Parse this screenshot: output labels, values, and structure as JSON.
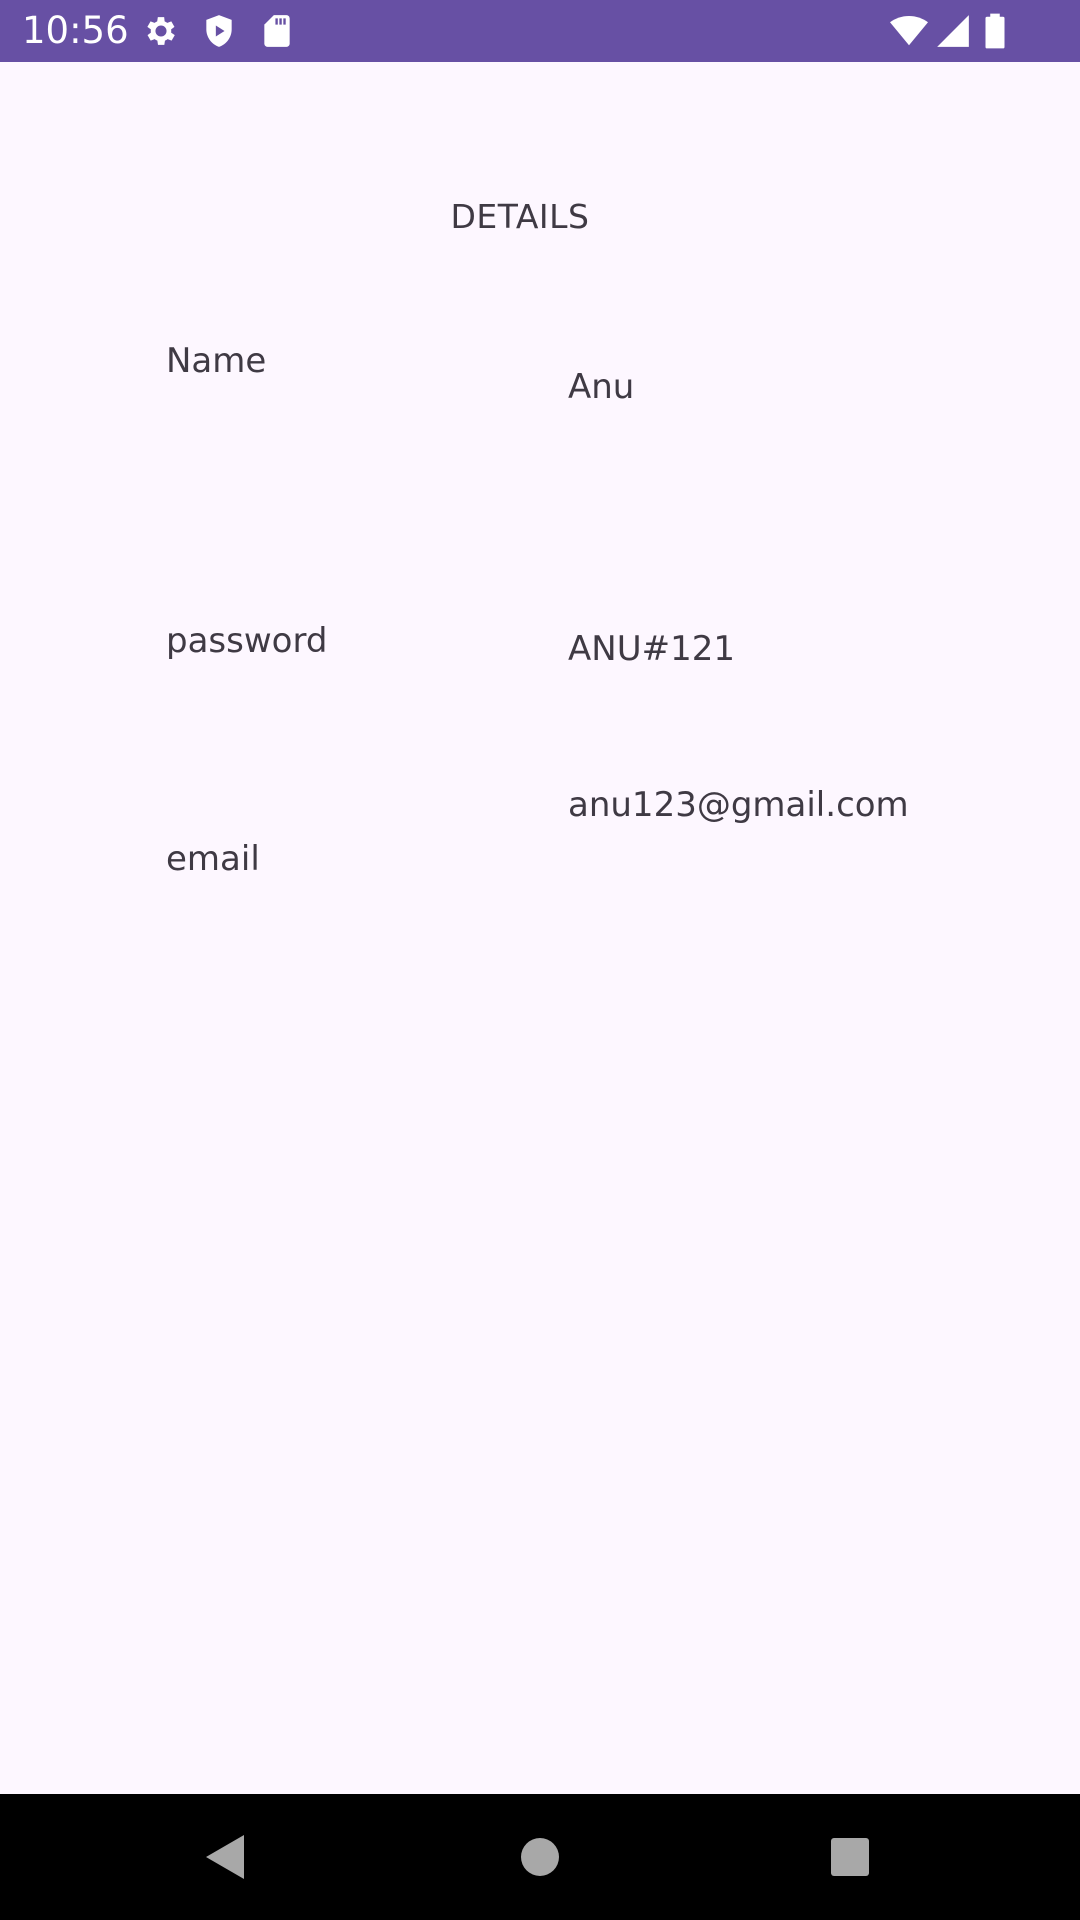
{
  "status_bar": {
    "time": "10:56",
    "color": "#6750a4",
    "left_icons": [
      "settings-icon",
      "shield-play-icon",
      "sd-card-icon"
    ],
    "right_icons": [
      "wifi-icon",
      "signal-icon",
      "battery-icon"
    ]
  },
  "page": {
    "title": "DETAILS",
    "background": "#fdf7ff"
  },
  "details": [
    {
      "label": "Name",
      "value": "Anu"
    },
    {
      "label": "password",
      "value": "ANU#121"
    },
    {
      "label": "email",
      "value": "anu123@gmail.com"
    }
  ],
  "nav_bar": {
    "buttons": [
      "back-icon",
      "home-icon",
      "recents-icon"
    ]
  }
}
